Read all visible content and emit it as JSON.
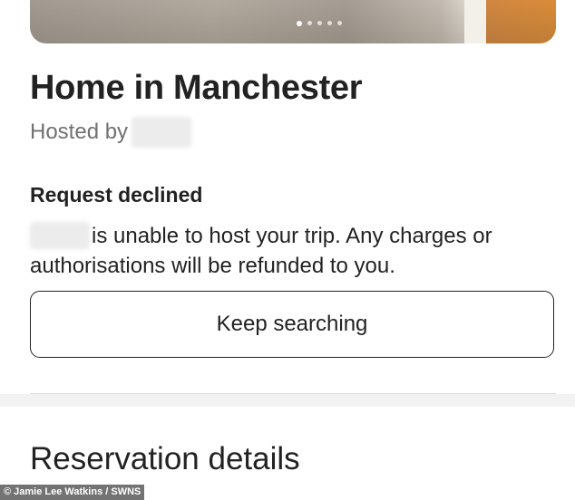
{
  "carousel": {
    "dot_count": 5,
    "active_index": 0
  },
  "listing": {
    "title": "Home in Manchester",
    "hosted_by_label": "Hosted by"
  },
  "request": {
    "status": "Request declined",
    "message": "is unable to host your trip. Any charges or authorisations will be refunded to you."
  },
  "actions": {
    "keep_searching_label": "Keep searching"
  },
  "reservation": {
    "heading": "Reservation details"
  },
  "credit": {
    "text": "© Jamie Lee Watkins / SWNS"
  },
  "colors": {
    "text_primary": "#222222",
    "text_secondary": "#717171",
    "divider": "#dddddd"
  }
}
